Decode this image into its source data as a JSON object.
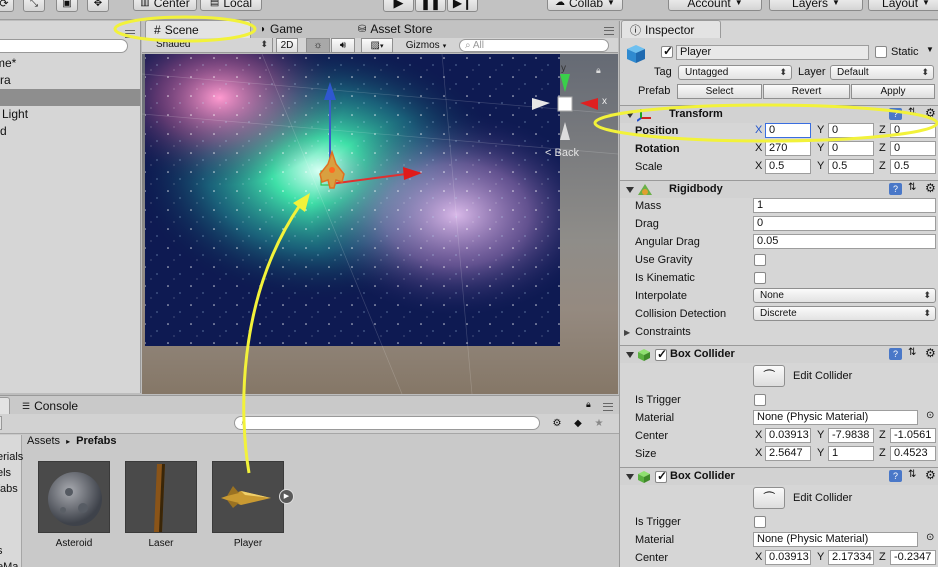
{
  "toolbar": {
    "center_label": "Center",
    "local_label": "Local",
    "collab_label": "Collab",
    "account_label": "Account",
    "layers_label": "Layers",
    "layout_label": "Layout"
  },
  "hierarchy": {
    "items": [
      "me*",
      "ra",
      "",
      "Light",
      "d"
    ]
  },
  "scene": {
    "tabs": [
      "Scene",
      "Game",
      "Asset Store"
    ],
    "shading": "Shaded",
    "mode_2d": "2D",
    "gizmos": "Gizmos",
    "search_placeholder": "All",
    "axis_y": "y",
    "axis_x": "x",
    "back_label": "Back"
  },
  "project": {
    "tab_console": "Console",
    "breadcrumb_root": "Assets",
    "breadcrumb_current": "Prefabs",
    "left_items": [
      "erials",
      "els",
      "fabs",
      "s",
      "eMa"
    ],
    "assets": [
      "Asteroid",
      "Laser",
      "Player"
    ]
  },
  "inspector": {
    "tab_label": "Inspector",
    "object_name": "Player",
    "static_label": "Static",
    "tag_label": "Tag",
    "tag_value": "Untagged",
    "layer_label": "Layer",
    "layer_value": "Default",
    "prefab_label": "Prefab",
    "prefab_buttons": [
      "Select",
      "Revert",
      "Apply"
    ],
    "transform": {
      "title": "Transform",
      "position_label": "Position",
      "position": {
        "x": "0",
        "y": "0",
        "z": "0"
      },
      "rotation_label": "Rotation",
      "rotation": {
        "x": "270",
        "y": "0",
        "z": "0"
      },
      "scale_label": "Scale",
      "scale": {
        "x": "0.5",
        "y": "0.5",
        "z": "0.5"
      }
    },
    "rigidbody": {
      "title": "Rigidbody",
      "mass_label": "Mass",
      "mass": "1",
      "drag_label": "Drag",
      "drag": "0",
      "angular_drag_label": "Angular Drag",
      "angular_drag": "0.05",
      "use_gravity_label": "Use Gravity",
      "is_kinematic_label": "Is Kinematic",
      "interpolate_label": "Interpolate",
      "interpolate": "None",
      "collision_label": "Collision Detection",
      "collision": "Discrete",
      "constraints_label": "Constraints"
    },
    "box_collider_1": {
      "title": "Box Collider",
      "edit_label": "Edit Collider",
      "is_trigger_label": "Is Trigger",
      "material_label": "Material",
      "material": "None (Physic Material)",
      "center_label": "Center",
      "center": {
        "x": "0.03913",
        "y": "-7.9838",
        "z": "-1.0561"
      },
      "size_label": "Size",
      "size": {
        "x": "2.5647",
        "y": "1",
        "z": "0.4523"
      }
    },
    "box_collider_2": {
      "title": "Box Collider",
      "edit_label": "Edit Collider",
      "is_trigger_label": "Is Trigger",
      "material_label": "Material",
      "material": "None (Physic Material)",
      "center_label": "Center",
      "center": {
        "x": "0.03913",
        "y": "2.17334",
        "z": "-0.2347"
      }
    },
    "axis_labels": {
      "x": "X",
      "y": "Y",
      "z": "Z"
    }
  },
  "colors": {
    "annotation": "#f2f23a",
    "selected_axis": "#2255cc"
  }
}
